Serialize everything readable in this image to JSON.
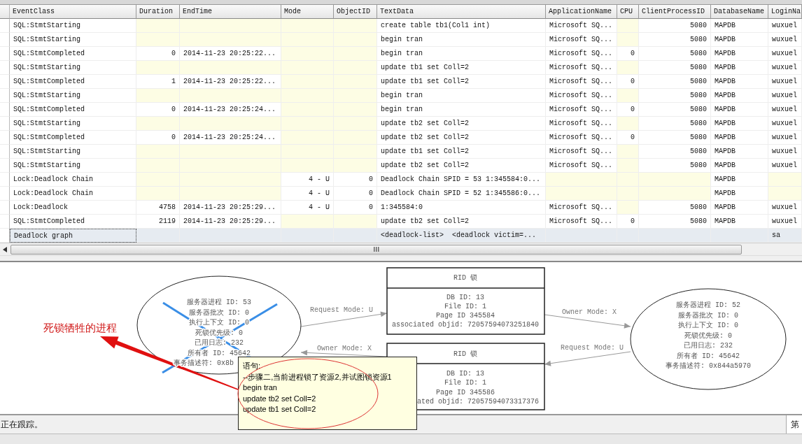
{
  "table": {
    "columns": [
      "EventClass",
      "Duration",
      "EndTime",
      "Mode",
      "ObjectID",
      "TextData",
      "ApplicationName",
      "CPU",
      "ClientProcessID",
      "DatabaseName",
      "LoginNa"
    ],
    "rows": [
      {
        "selected": false,
        "cells": [
          "SQL:StmtStarting",
          null,
          null,
          null,
          null,
          "create table tb1(Col1 int)",
          "Microsoft SQ...",
          null,
          "5080",
          "MAPDB",
          "wuxuel"
        ]
      },
      {
        "selected": false,
        "cells": [
          "SQL:StmtStarting",
          null,
          null,
          null,
          null,
          "begin tran",
          "Microsoft SQ...",
          null,
          "5080",
          "MAPDB",
          "wuxuel"
        ]
      },
      {
        "selected": false,
        "cells": [
          "SQL:StmtCompleted",
          "0",
          "2014-11-23 20:25:22...",
          null,
          null,
          "begin tran",
          "Microsoft SQ...",
          "0",
          "5080",
          "MAPDB",
          "wuxuel"
        ]
      },
      {
        "selected": false,
        "cells": [
          "SQL:StmtStarting",
          null,
          null,
          null,
          null,
          "update tb1 set Coll=2",
          "Microsoft SQ...",
          null,
          "5080",
          "MAPDB",
          "wuxuel"
        ]
      },
      {
        "selected": false,
        "cells": [
          "SQL:StmtCompleted",
          "1",
          "2014-11-23 20:25:22...",
          null,
          null,
          "update tb1 set Coll=2",
          "Microsoft SQ...",
          "0",
          "5080",
          "MAPDB",
          "wuxuel"
        ]
      },
      {
        "selected": false,
        "cells": [
          "SQL:StmtStarting",
          null,
          null,
          null,
          null,
          "begin tran",
          "Microsoft SQ...",
          null,
          "5080",
          "MAPDB",
          "wuxuel"
        ]
      },
      {
        "selected": false,
        "cells": [
          "SQL:StmtCompleted",
          "0",
          "2014-11-23 20:25:24...",
          null,
          null,
          "begin tran",
          "Microsoft SQ...",
          "0",
          "5080",
          "MAPDB",
          "wuxuel"
        ]
      },
      {
        "selected": false,
        "cells": [
          "SQL:StmtStarting",
          null,
          null,
          null,
          null,
          "update tb2 set Coll=2",
          "Microsoft SQ...",
          null,
          "5080",
          "MAPDB",
          "wuxuel"
        ]
      },
      {
        "selected": false,
        "cells": [
          "SQL:StmtCompleted",
          "0",
          "2014-11-23 20:25:24...",
          null,
          null,
          "update tb2 set Coll=2",
          "Microsoft SQ...",
          "0",
          "5080",
          "MAPDB",
          "wuxuel"
        ]
      },
      {
        "selected": false,
        "cells": [
          "SQL:StmtStarting",
          null,
          null,
          null,
          null,
          "update tb1 set Coll=2",
          "Microsoft SQ...",
          null,
          "5080",
          "MAPDB",
          "wuxuel"
        ]
      },
      {
        "selected": false,
        "cells": [
          "SQL:StmtStarting",
          null,
          null,
          null,
          null,
          "update tb2 set Coll=2",
          "Microsoft SQ...",
          null,
          "5080",
          "MAPDB",
          "wuxuel"
        ]
      },
      {
        "selected": false,
        "cells": [
          "Lock:Deadlock Chain",
          null,
          null,
          "4 - U",
          "0",
          "Deadlock Chain SPID = 53 1:345584:0...",
          null,
          null,
          null,
          "MAPDB",
          null
        ]
      },
      {
        "selected": false,
        "cells": [
          "Lock:Deadlock Chain",
          null,
          null,
          "4 - U",
          "0",
          "Deadlock Chain SPID = 52 1:345586:0...",
          null,
          null,
          null,
          "MAPDB",
          null
        ]
      },
      {
        "selected": false,
        "cells": [
          "Lock:Deadlock",
          "4758",
          "2014-11-23 20:25:29...",
          "4 - U",
          "0",
          "1:345584:0",
          "Microsoft SQ...",
          null,
          "5080",
          "MAPDB",
          "wuxuel"
        ]
      },
      {
        "selected": false,
        "cells": [
          "SQL:StmtCompleted",
          "2119",
          "2014-11-23 20:25:29...",
          null,
          null,
          "update tb2 set Coll=2",
          "Microsoft SQ...",
          "0",
          "5080",
          "MAPDB",
          "wuxuel"
        ]
      },
      {
        "selected": true,
        "cells": [
          "Deadlock graph",
          null,
          null,
          null,
          null,
          "<deadlock-list>  <deadlock victim=...",
          null,
          null,
          null,
          null,
          "sa"
        ]
      }
    ]
  },
  "deadlock_graph": {
    "processes": [
      {
        "victim": true,
        "lines": [
          "服务器进程 ID: 53",
          "服务器批次 ID: 0",
          "执行上下文 ID: 0",
          "死锁优先级: 0",
          "已用日志: 232",
          "所有者 ID: 45642",
          "事务描述符: 0x8b"
        ]
      },
      {
        "victim": false,
        "lines": [
          "服务器进程 ID: 52",
          "服务器批次 ID: 0",
          "执行上下文 ID: 0",
          "死锁优先级: 0",
          "已用日志: 232",
          "所有者 ID: 45642",
          "事务描述符: 0x844a5970"
        ]
      }
    ],
    "resources": [
      {
        "title": "RID 锁",
        "lines": [
          "DB ID: 13",
          "File ID: 1",
          "Page ID 345584",
          "associated objid: 72057594073251840"
        ]
      },
      {
        "title": "RID 锁",
        "lines": [
          "DB ID: 13",
          "File ID: 1",
          "Page ID 345586",
          "ated objid: 72057594073317376"
        ]
      }
    ],
    "edges": [
      {
        "label": "Request Mode: U"
      },
      {
        "label": "Owner Mode: X"
      },
      {
        "label": "Owner Mode: X"
      },
      {
        "label": "Request Mode: U"
      }
    ]
  },
  "annotation": {
    "text": "死锁牺牲的进程"
  },
  "tooltip": {
    "title": "语句:",
    "lines": [
      "--步骤二,当前进程锁了资源2,并试图锁资源1",
      "begin tran",
      "update tb2 set Coll=2",
      "update tb1 set Coll=2"
    ]
  },
  "status_bar": {
    "text": "正在跟踪。",
    "panel": "第"
  }
}
